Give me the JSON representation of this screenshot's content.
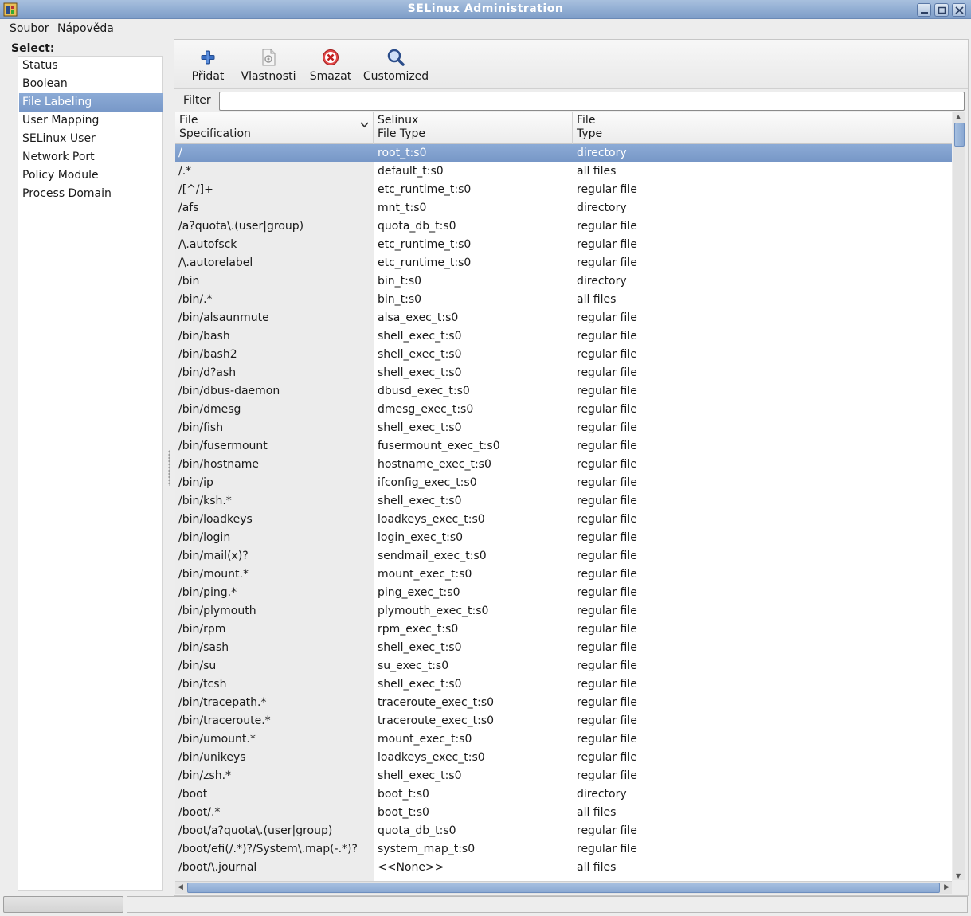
{
  "window": {
    "title": "SELinux Administration"
  },
  "menubar": {
    "items": [
      "Soubor",
      "Nápověda"
    ]
  },
  "sidebar": {
    "heading": "Select:",
    "selected": "File Labeling",
    "items": [
      "Status",
      "Boolean",
      "File Labeling",
      "User Mapping",
      "SELinux User",
      "Network Port",
      "Policy Module",
      "Process Domain"
    ]
  },
  "toolbar": {
    "buttons": [
      {
        "label": "Přidat",
        "icon": "add-icon"
      },
      {
        "label": "Vlastnosti",
        "icon": "properties-icon"
      },
      {
        "label": "Smazat",
        "icon": "delete-icon"
      },
      {
        "label": "Customized",
        "icon": "search-icon"
      }
    ]
  },
  "filter": {
    "label": "Filter",
    "value": ""
  },
  "table": {
    "headers": [
      {
        "line1": "File",
        "line2": "Specification"
      },
      {
        "line1": "Selinux",
        "line2": "File Type"
      },
      {
        "line1": "File",
        "line2": "Type"
      }
    ],
    "selected_row": 0,
    "rows": [
      [
        "/",
        "root_t:s0",
        "directory"
      ],
      [
        "/.*",
        "default_t:s0",
        "all files"
      ],
      [
        "/[^/]+",
        "etc_runtime_t:s0",
        "regular file"
      ],
      [
        "/afs",
        "mnt_t:s0",
        "directory"
      ],
      [
        "/a?quota\\.(user|group)",
        "quota_db_t:s0",
        "regular file"
      ],
      [
        "/\\.autofsck",
        "etc_runtime_t:s0",
        "regular file"
      ],
      [
        "/\\.autorelabel",
        "etc_runtime_t:s0",
        "regular file"
      ],
      [
        "/bin",
        "bin_t:s0",
        "directory"
      ],
      [
        "/bin/.*",
        "bin_t:s0",
        "all files"
      ],
      [
        "/bin/alsaunmute",
        "alsa_exec_t:s0",
        "regular file"
      ],
      [
        "/bin/bash",
        "shell_exec_t:s0",
        "regular file"
      ],
      [
        "/bin/bash2",
        "shell_exec_t:s0",
        "regular file"
      ],
      [
        "/bin/d?ash",
        "shell_exec_t:s0",
        "regular file"
      ],
      [
        "/bin/dbus-daemon",
        "dbusd_exec_t:s0",
        "regular file"
      ],
      [
        "/bin/dmesg",
        "dmesg_exec_t:s0",
        "regular file"
      ],
      [
        "/bin/fish",
        "shell_exec_t:s0",
        "regular file"
      ],
      [
        "/bin/fusermount",
        "fusermount_exec_t:s0",
        "regular file"
      ],
      [
        "/bin/hostname",
        "hostname_exec_t:s0",
        "regular file"
      ],
      [
        "/bin/ip",
        "ifconfig_exec_t:s0",
        "regular file"
      ],
      [
        "/bin/ksh.*",
        "shell_exec_t:s0",
        "regular file"
      ],
      [
        "/bin/loadkeys",
        "loadkeys_exec_t:s0",
        "regular file"
      ],
      [
        "/bin/login",
        "login_exec_t:s0",
        "regular file"
      ],
      [
        "/bin/mail(x)?",
        "sendmail_exec_t:s0",
        "regular file"
      ],
      [
        "/bin/mount.*",
        "mount_exec_t:s0",
        "regular file"
      ],
      [
        "/bin/ping.*",
        "ping_exec_t:s0",
        "regular file"
      ],
      [
        "/bin/plymouth",
        "plymouth_exec_t:s0",
        "regular file"
      ],
      [
        "/bin/rpm",
        "rpm_exec_t:s0",
        "regular file"
      ],
      [
        "/bin/sash",
        "shell_exec_t:s0",
        "regular file"
      ],
      [
        "/bin/su",
        "su_exec_t:s0",
        "regular file"
      ],
      [
        "/bin/tcsh",
        "shell_exec_t:s0",
        "regular file"
      ],
      [
        "/bin/tracepath.*",
        "traceroute_exec_t:s0",
        "regular file"
      ],
      [
        "/bin/traceroute.*",
        "traceroute_exec_t:s0",
        "regular file"
      ],
      [
        "/bin/umount.*",
        "mount_exec_t:s0",
        "regular file"
      ],
      [
        "/bin/unikeys",
        "loadkeys_exec_t:s0",
        "regular file"
      ],
      [
        "/bin/zsh.*",
        "shell_exec_t:s0",
        "regular file"
      ],
      [
        "/boot",
        "boot_t:s0",
        "directory"
      ],
      [
        "/boot/.*",
        "boot_t:s0",
        "all files"
      ],
      [
        "/boot/a?quota\\.(user|group)",
        "quota_db_t:s0",
        "regular file"
      ],
      [
        "/boot/efi(/.*)?/System\\.map(-.*)?",
        "system_map_t:s0",
        "regular file"
      ],
      [
        "/boot/\\.journal",
        "<<None>>",
        "all files"
      ]
    ]
  },
  "statusbar": {
    "left": "",
    "right": ""
  }
}
